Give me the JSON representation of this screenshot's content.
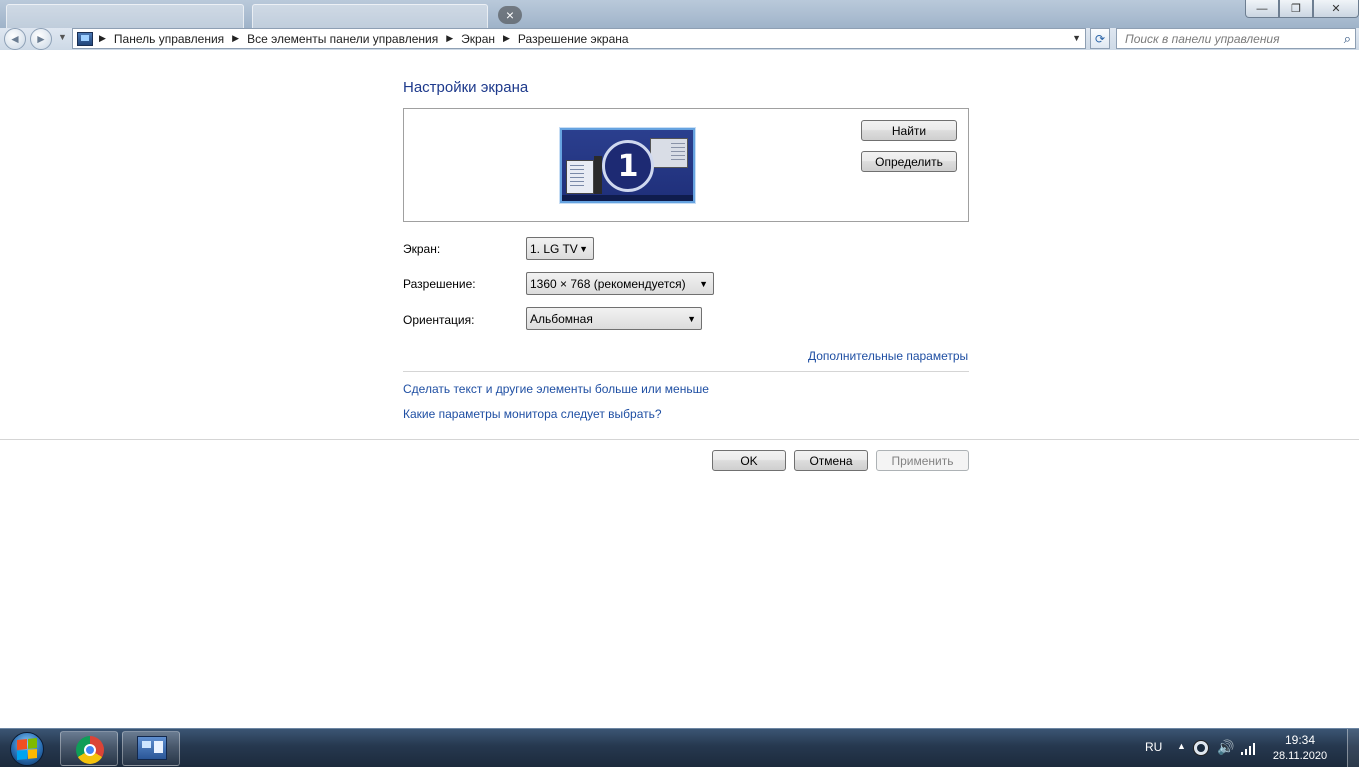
{
  "window": {
    "controls": {
      "minimize": "—",
      "maximize": "❐",
      "close": "✕"
    }
  },
  "browser_ghost": {
    "newtab_glyph": "×"
  },
  "nav": {
    "back_glyph": "◄",
    "forward_glyph": "►",
    "dropdown_glyph": "▼"
  },
  "address_bar": {
    "breadcrumbs": [
      "Панель управления",
      "Все элементы панели управления",
      "Экран",
      "Разрешение экрана"
    ],
    "dropdown_glyph": "▼",
    "refresh_glyph": "⟳",
    "separator_glyph": "▶"
  },
  "search": {
    "placeholder": "Поиск в панели управления",
    "icon": "magnifier-icon"
  },
  "page": {
    "title": "Настройки экрана",
    "monitor_number": "1",
    "find_button": "Найти",
    "identify_button": "Определить",
    "fields": {
      "screen_label": "Экран:",
      "screen_value": "1. LG TV",
      "resolution_label": "Разрешение:",
      "resolution_value": "1360 × 768 (рекомендуется)",
      "orientation_label": "Ориентация:",
      "orientation_value": "Альбомная"
    },
    "advanced_link": "Дополнительные параметры",
    "links": [
      "Сделать текст и другие элементы больше или меньше",
      "Какие параметры монитора следует выбрать?"
    ],
    "ok_button": "OK",
    "cancel_button": "Отмена",
    "apply_button": "Применить"
  },
  "taskbar": {
    "apps": [
      "chrome-icon",
      "control-panel-icon"
    ],
    "tray": {
      "language": "RU",
      "up_glyph": "▲",
      "volume_glyph": "🔊",
      "time": "19:34",
      "date": "28.11.2020"
    }
  },
  "colors": {
    "title_blue": "#1e3a8c",
    "link_blue": "#1f4fa3",
    "taskbar": "#26384f"
  }
}
